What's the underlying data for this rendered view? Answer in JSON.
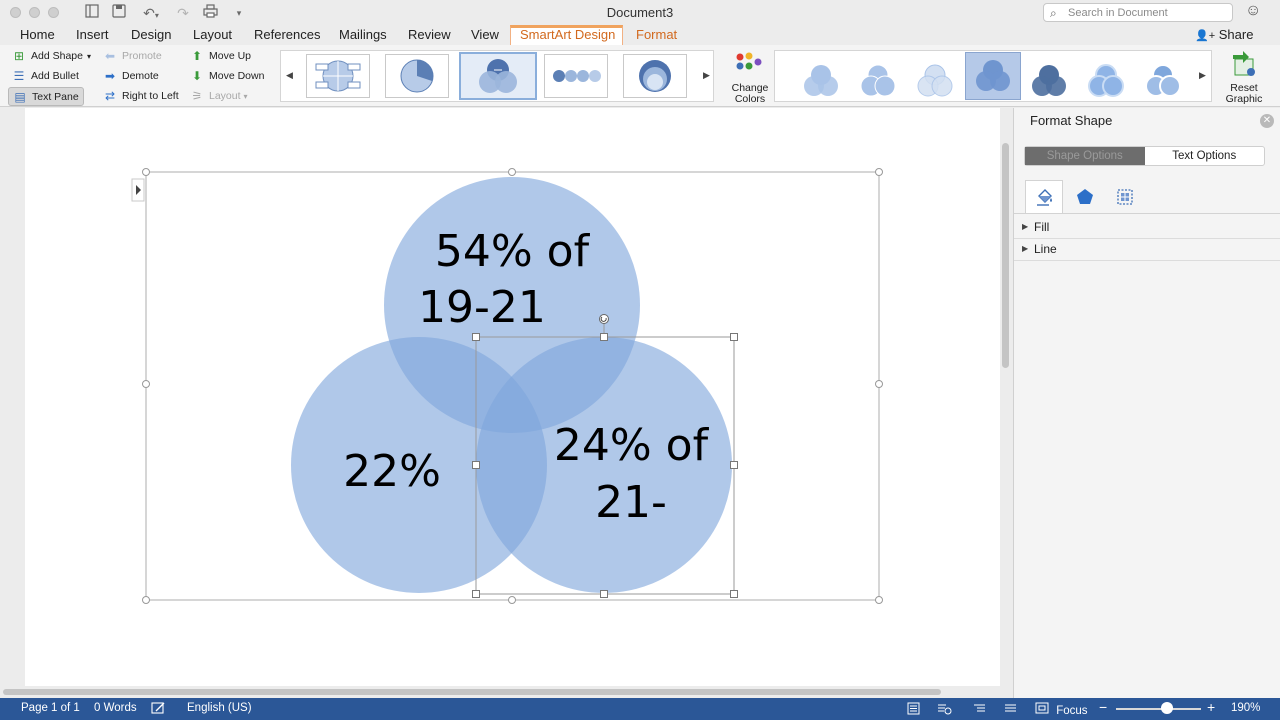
{
  "window": {
    "title": "Document3"
  },
  "search": {
    "placeholder": "Search in Document"
  },
  "tabs": [
    {
      "label": "Home"
    },
    {
      "label": "Insert"
    },
    {
      "label": "Design"
    },
    {
      "label": "Layout"
    },
    {
      "label": "References"
    },
    {
      "label": "Mailings"
    },
    {
      "label": "Review"
    },
    {
      "label": "View"
    },
    {
      "label": "SmartArt Design"
    },
    {
      "label": "Format"
    }
  ],
  "share_label": "Share",
  "ribbon": {
    "add_shape": "Add Shape",
    "add_bullet": "Add Bullet",
    "text_pane": "Text Pane",
    "promote": "Promote",
    "demote": "Demote",
    "right_to_left": "Right to Left",
    "move_up": "Move Up",
    "move_down": "Move Down",
    "layout": "Layout",
    "change_colors_1": "Change",
    "change_colors_2": "Colors",
    "reset_1": "Reset",
    "reset_2": "Graphic"
  },
  "smartart": {
    "top": "54% of",
    "top_2": "19-21",
    "left": "22%",
    "right": "24% of",
    "right_2": "21-"
  },
  "colors": {
    "circle": "#7fa7dc",
    "status_bar": "#2b5797",
    "accent": "#d2691e"
  },
  "pane": {
    "title": "Format Shape",
    "shape_options": "Shape Options",
    "text_options": "Text Options",
    "fill": "Fill",
    "line": "Line"
  },
  "status": {
    "page": "Page 1 of 1",
    "words": "0 Words",
    "language": "English (US)",
    "focus": "Focus",
    "zoom": "190%"
  }
}
